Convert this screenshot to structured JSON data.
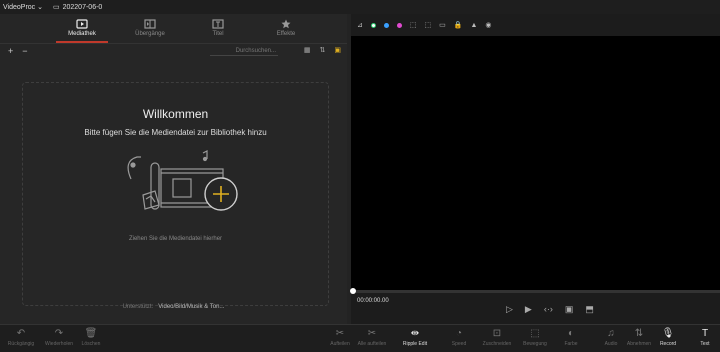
{
  "app": {
    "name": "VideoProc",
    "project": "202207-06-0"
  },
  "tabs": [
    {
      "label": "Mediathek",
      "icon": "media-library-icon"
    },
    {
      "label": "Übergänge",
      "icon": "transitions-icon"
    },
    {
      "label": "Titel",
      "icon": "title-icon"
    },
    {
      "label": "Effekte",
      "icon": "effects-icon"
    }
  ],
  "toolbar": {
    "add": "+",
    "remove": "−",
    "search_placeholder": "Durchsuchen..."
  },
  "library": {
    "welcome": "Willkommen",
    "prompt": "Bitte fügen Sie die Mediendatei zur Bibliothek hinzu",
    "drag_hint": "Ziehen Sie die Mediendatei hierher",
    "supported_label": "Unterstützt:",
    "supported_value": "Video/Bild/Musik & Ton..."
  },
  "player": {
    "time": "00:00:00.00"
  },
  "bottom_tools": [
    {
      "label": "Rückgängig",
      "glyph": "↶",
      "enabled": false
    },
    {
      "label": "Wiederholen",
      "glyph": "↷",
      "enabled": false
    },
    {
      "label": "Löschen",
      "glyph": "🗑",
      "enabled": false
    },
    {
      "label": "Aufteilen",
      "glyph": "✂",
      "enabled": false
    },
    {
      "label": "Alle aufteilen",
      "glyph": "✂",
      "enabled": false
    },
    {
      "label": "Ripple Edit",
      "glyph": "⇹",
      "enabled": true
    },
    {
      "label": "Speed",
      "glyph": "◔",
      "enabled": false
    },
    {
      "label": "Zuschneiden",
      "glyph": "⊡",
      "enabled": false
    },
    {
      "label": "Bewegung",
      "glyph": "⬚",
      "enabled": false
    },
    {
      "label": "Farbe",
      "glyph": "◐",
      "enabled": false
    },
    {
      "label": "Audio",
      "glyph": "♫",
      "enabled": false
    },
    {
      "label": "Abnehmen",
      "glyph": "⇅",
      "enabled": false
    },
    {
      "label": "Record",
      "glyph": "🎙",
      "enabled": true
    },
    {
      "label": "Text",
      "glyph": "T",
      "enabled": true
    }
  ]
}
